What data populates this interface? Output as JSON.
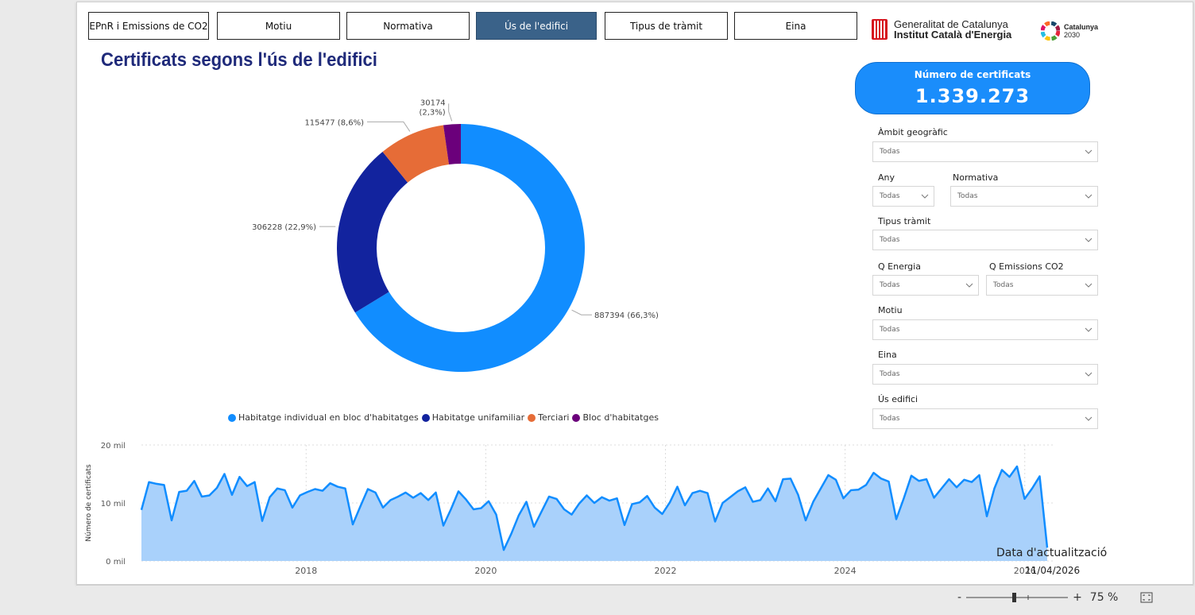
{
  "nav": {
    "tabs": [
      {
        "label": "EPnR i Emissions de CO2"
      },
      {
        "label": "Motiu"
      },
      {
        "label": "Normativa"
      },
      {
        "label": "Ús de l'edifici"
      },
      {
        "label": "Tipus de tràmit"
      },
      {
        "label": "Eina"
      }
    ],
    "active_index": 3
  },
  "branding": {
    "gen_line1": "Generalitat de Catalunya",
    "gen_line2": "Institut Català d'Energia",
    "cat_line1": "Catalunya",
    "cat_line2": "2030"
  },
  "page_title": "Certificats segons l'ús de l'edifici",
  "kpi": {
    "label": "Número de certificats",
    "value": "1.339.273"
  },
  "filters": {
    "ambit": {
      "label": "Àmbit geogràfic",
      "value": "Todas"
    },
    "any": {
      "label": "Any",
      "value": "Todas"
    },
    "normativa": {
      "label": "Normativa",
      "value": "Todas"
    },
    "tipus": {
      "label": "Tipus tràmit",
      "value": "Todas"
    },
    "qenergia": {
      "label": "Q Energia",
      "value": "Todas"
    },
    "qemissions": {
      "label": "Q Emissions CO2",
      "value": "Todas"
    },
    "motiu": {
      "label": "Motiu",
      "value": "Todas"
    },
    "eina": {
      "label": "Eina",
      "value": "Todas"
    },
    "us": {
      "label": "Ús edifici",
      "value": "Todas"
    }
  },
  "updated": {
    "label": "Data d'actualització",
    "value": "11/04/2026"
  },
  "zoom": {
    "minus": "-",
    "plus": "+",
    "level": "75 %"
  },
  "colors": {
    "blue": "#118dff",
    "navy": "#12239e",
    "orange": "#e66c37",
    "purple": "#6b007b",
    "area_fill": "#a9d1fb",
    "accent": "#3a6289"
  },
  "chart_data": [
    {
      "type": "pie",
      "variant": "donut",
      "slices": [
        {
          "name": "Habitatge individual en bloc d'habitatges",
          "value": 887394,
          "label": "887394 (66,3%)",
          "color": "#118dff"
        },
        {
          "name": "Habitatge unifamiliar",
          "value": 306228,
          "label": "306228 (22,9%)",
          "color": "#12239e"
        },
        {
          "name": "Terciari",
          "value": 115477,
          "label": "115477 (8,6%)",
          "color": "#e66c37"
        },
        {
          "name": "Bloc d'habitatges",
          "value": 30174,
          "label_line1": "30174",
          "label_line2": "(2,3%)",
          "color": "#6b007b"
        }
      ],
      "legend_position": "bottom"
    },
    {
      "type": "area",
      "ylabel": "Número de certificats",
      "y_ticks": [
        "0 mil",
        "10 mil",
        "20 mil"
      ],
      "ylim": [
        0,
        20000
      ],
      "x_ticks": [
        "2018",
        "2020",
        "2022",
        "2024",
        "2026"
      ],
      "x_tick_values": [
        2018,
        2020,
        2022,
        2024,
        2026
      ],
      "x_start": "2016-03",
      "x_end": "2026-04",
      "grid": true,
      "values": [
        8800,
        13600,
        13300,
        13100,
        7000,
        11900,
        12100,
        13800,
        11100,
        11300,
        12600,
        15000,
        11400,
        14500,
        12900,
        13600,
        6900,
        11000,
        12500,
        12200,
        9200,
        11300,
        11900,
        12400,
        12100,
        13400,
        12800,
        12500,
        6300,
        9400,
        12400,
        11800,
        9200,
        10500,
        11100,
        11800,
        10900,
        11700,
        10500,
        11800,
        6100,
        8900,
        12000,
        10600,
        8900,
        9100,
        10300,
        8000,
        1900,
        4700,
        7900,
        10200,
        5900,
        8500,
        11100,
        10700,
        8900,
        8000,
        9900,
        11300,
        10000,
        11000,
        10400,
        10800,
        6200,
        9800,
        10100,
        11200,
        9200,
        8100,
        10100,
        12800,
        9600,
        11700,
        12100,
        11700,
        6800,
        10000,
        11000,
        12000,
        12700,
        10200,
        10500,
        12500,
        10300,
        14100,
        14200,
        11400,
        7000,
        10200,
        12500,
        14800,
        14000,
        10800,
        12200,
        12300,
        13100,
        15200,
        14200,
        13700,
        7200,
        10800,
        14700,
        13800,
        14100,
        10900,
        12500,
        14100,
        12700,
        14000,
        13600,
        14800,
        7700,
        12500,
        15700,
        14500,
        16300,
        10700,
        12500,
        14600,
        2300
      ]
    }
  ]
}
